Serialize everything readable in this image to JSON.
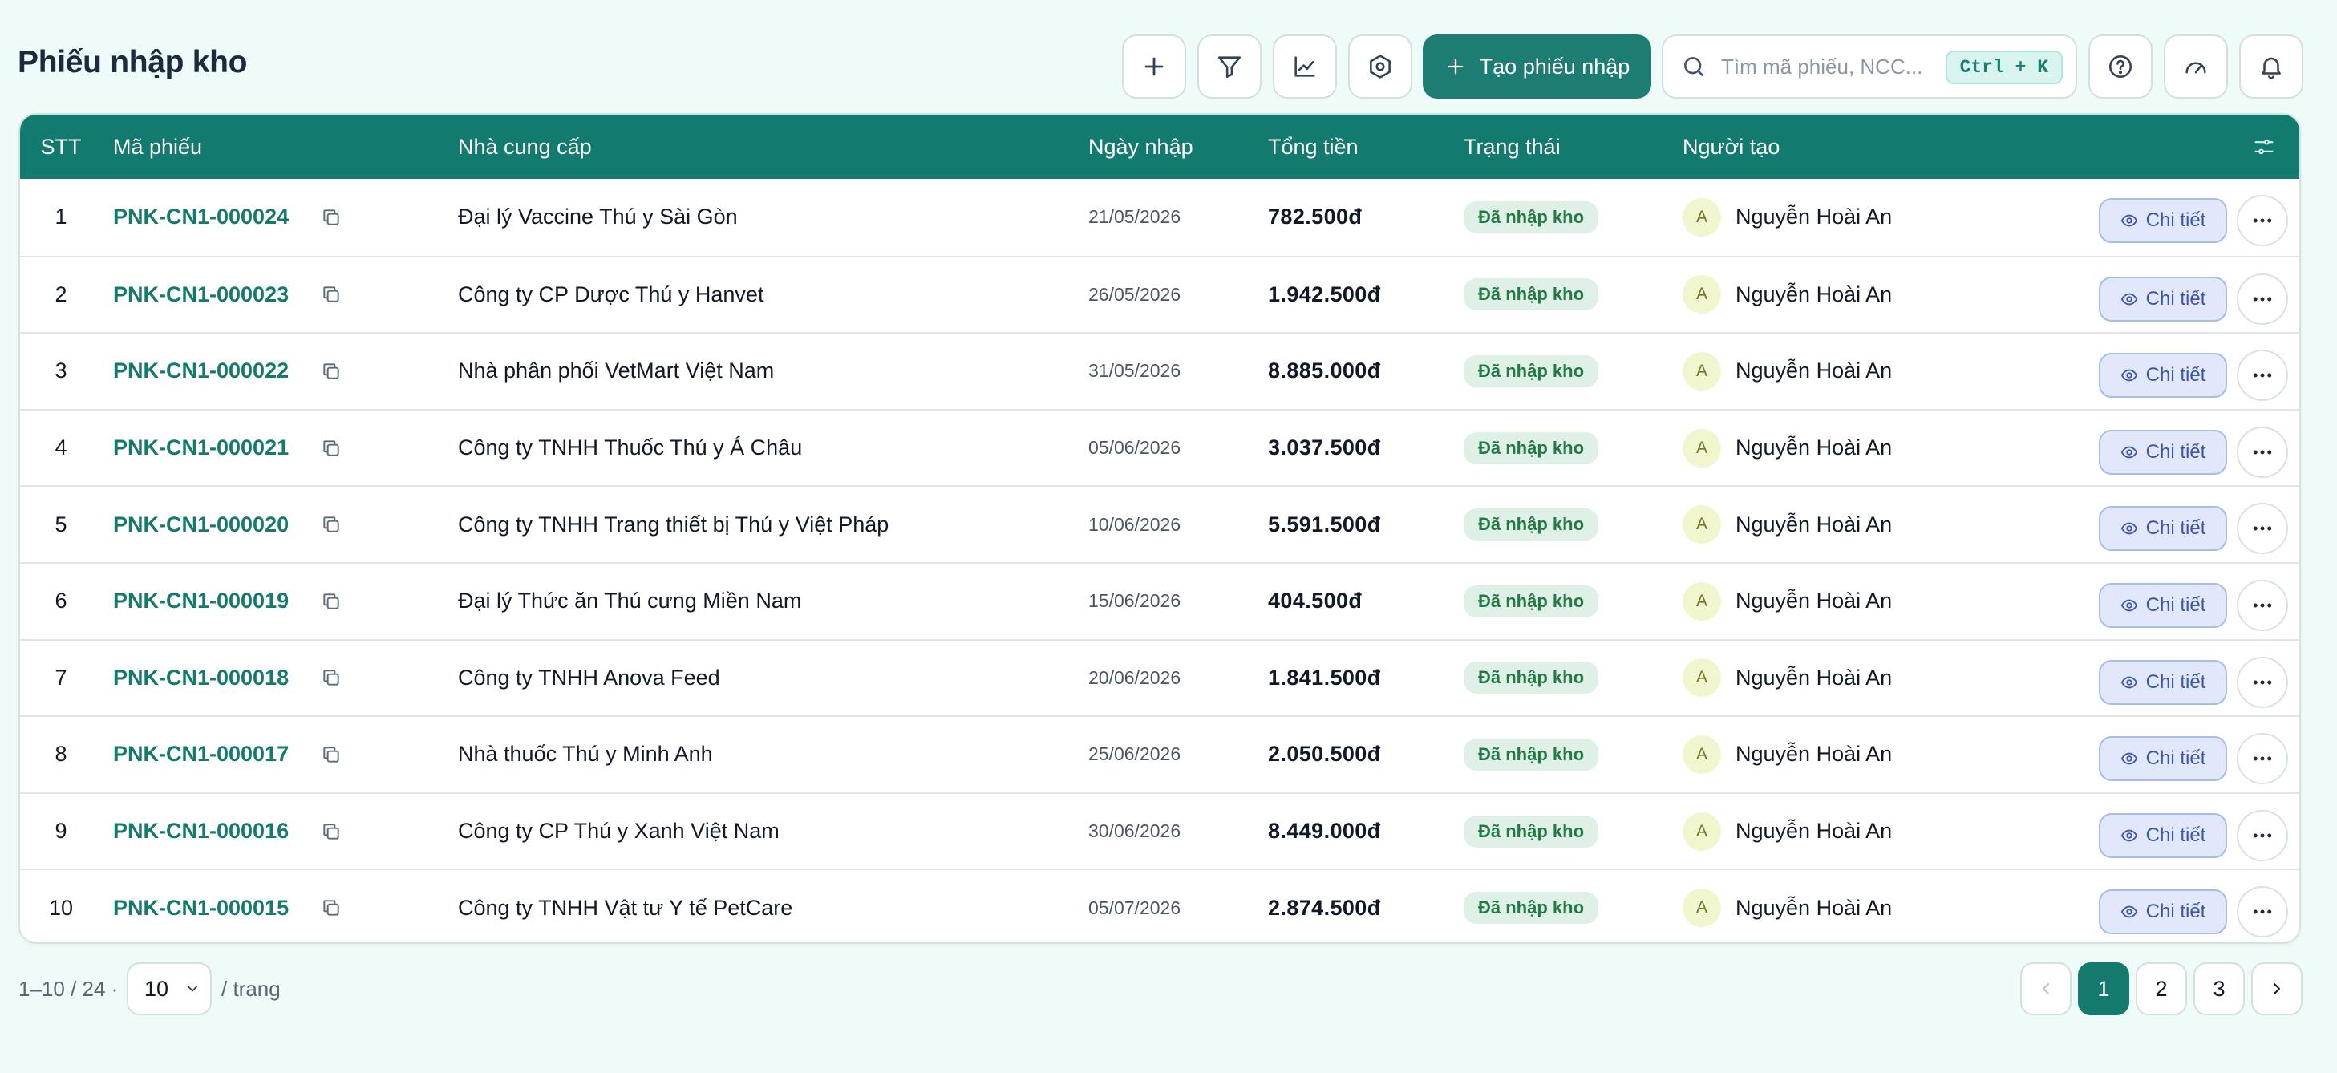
{
  "page": {
    "title": "Phiếu nhập kho"
  },
  "toolbar": {
    "create_label": "Tạo phiếu nhập",
    "search_placeholder": "Tìm mã phiếu, NCC...",
    "shortcut": "Ctrl + K",
    "icons": [
      "plus-icon",
      "filter-icon",
      "chart-icon",
      "settings-icon",
      "help-icon",
      "speedometer-icon",
      "bell-icon"
    ]
  },
  "table": {
    "columns": {
      "stt": "STT",
      "code": "Mã phiếu",
      "supplier": "Nhà cung cấp",
      "date": "Ngày nhập",
      "total": "Tổng tiền",
      "status": "Trạng thái",
      "creator": "Người tạo"
    },
    "detail_label": "Chi tiết",
    "rows": [
      {
        "stt": "1",
        "code": "PNK-CN1-000024",
        "supplier": "Đại lý Vaccine Thú y Sài Gòn",
        "date": "21/05/2026",
        "total": "782.500đ",
        "status": "Đã nhập kho",
        "avatar": "A",
        "creator": "Nguyễn Hoài An"
      },
      {
        "stt": "2",
        "code": "PNK-CN1-000023",
        "supplier": "Công ty CP Dược Thú y Hanvet",
        "date": "26/05/2026",
        "total": "1.942.500đ",
        "status": "Đã nhập kho",
        "avatar": "A",
        "creator": "Nguyễn Hoài An"
      },
      {
        "stt": "3",
        "code": "PNK-CN1-000022",
        "supplier": "Nhà phân phối VetMart Việt Nam",
        "date": "31/05/2026",
        "total": "8.885.000đ",
        "status": "Đã nhập kho",
        "avatar": "A",
        "creator": "Nguyễn Hoài An"
      },
      {
        "stt": "4",
        "code": "PNK-CN1-000021",
        "supplier": "Công ty TNHH Thuốc Thú y Á Châu",
        "date": "05/06/2026",
        "total": "3.037.500đ",
        "status": "Đã nhập kho",
        "avatar": "A",
        "creator": "Nguyễn Hoài An"
      },
      {
        "stt": "5",
        "code": "PNK-CN1-000020",
        "supplier": "Công ty TNHH Trang thiết bị Thú y Việt Pháp",
        "date": "10/06/2026",
        "total": "5.591.500đ",
        "status": "Đã nhập kho",
        "avatar": "A",
        "creator": "Nguyễn Hoài An"
      },
      {
        "stt": "6",
        "code": "PNK-CN1-000019",
        "supplier": "Đại lý Thức ăn Thú cưng Miền Nam",
        "date": "15/06/2026",
        "total": "404.500đ",
        "status": "Đã nhập kho",
        "avatar": "A",
        "creator": "Nguyễn Hoài An"
      },
      {
        "stt": "7",
        "code": "PNK-CN1-000018",
        "supplier": "Công ty TNHH Anova Feed",
        "date": "20/06/2026",
        "total": "1.841.500đ",
        "status": "Đã nhập kho",
        "avatar": "A",
        "creator": "Nguyễn Hoài An"
      },
      {
        "stt": "8",
        "code": "PNK-CN1-000017",
        "supplier": "Nhà thuốc Thú y Minh Anh",
        "date": "25/06/2026",
        "total": "2.050.500đ",
        "status": "Đã nhập kho",
        "avatar": "A",
        "creator": "Nguyễn Hoài An"
      },
      {
        "stt": "9",
        "code": "PNK-CN1-000016",
        "supplier": "Công ty CP Thú y Xanh Việt Nam",
        "date": "30/06/2026",
        "total": "8.449.000đ",
        "status": "Đã nhập kho",
        "avatar": "A",
        "creator": "Nguyễn Hoài An"
      },
      {
        "stt": "10",
        "code": "PNK-CN1-000015",
        "supplier": "Công ty TNHH Vật tư Y tế PetCare",
        "date": "05/07/2026",
        "total": "2.874.500đ",
        "status": "Đã nhập kho",
        "avatar": "A",
        "creator": "Nguyễn Hoài An"
      }
    ]
  },
  "pagination": {
    "range": "1–10 / 24 ·",
    "page_size": "10",
    "per_page_label": "/ trang",
    "pages": [
      "1",
      "2",
      "3"
    ],
    "current": "1"
  },
  "colors": {
    "primary": "#137a6f",
    "background": "#eefbf8",
    "status_bg": "#dff1e6",
    "status_text": "#237a47",
    "detail_bg": "#e1e8fb"
  }
}
